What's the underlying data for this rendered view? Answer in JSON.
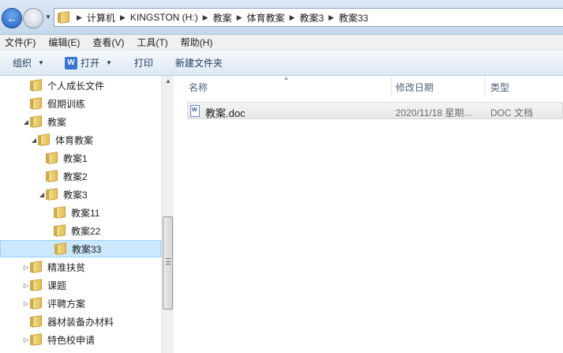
{
  "nav": {
    "back": "back-arrow",
    "forward": "forward-arrow"
  },
  "breadcrumb": [
    "计算机",
    "KINGSTON (H:)",
    "教案",
    "体育教案",
    "教案3",
    "教案33"
  ],
  "menu": [
    "文件(F)",
    "编辑(E)",
    "查看(V)",
    "工具(T)",
    "帮助(H)"
  ],
  "toolbar": {
    "organize": "组织",
    "open": "打开",
    "print": "打印",
    "new_folder": "新建文件夹"
  },
  "tree": [
    {
      "label": "个人成长文件",
      "expander": "",
      "level": 0
    },
    {
      "label": "假期训练",
      "expander": "",
      "level": 0
    },
    {
      "label": "教案",
      "expander": "expanded",
      "level": 0
    },
    {
      "label": "体育教案",
      "expander": "expanded",
      "level": 1
    },
    {
      "label": "教案1",
      "expander": "",
      "level": 2
    },
    {
      "label": "教案2",
      "expander": "",
      "level": 2
    },
    {
      "label": "教案3",
      "expander": "expanded",
      "level": 2
    },
    {
      "label": "教案11",
      "expander": "",
      "level": 3
    },
    {
      "label": "教案22",
      "expander": "",
      "level": 3
    },
    {
      "label": "教案33",
      "expander": "",
      "level": 3,
      "selected": true
    },
    {
      "label": "精准扶贫",
      "expander": "collapsed",
      "level": 0
    },
    {
      "label": "课题",
      "expander": "collapsed",
      "level": 0
    },
    {
      "label": "评聘方案",
      "expander": "collapsed",
      "level": 0
    },
    {
      "label": "器材装备办材料",
      "expander": "",
      "level": 0
    },
    {
      "label": "特色校申请",
      "expander": "collapsed",
      "level": 0
    }
  ],
  "columns": {
    "name": "名称",
    "date": "修改日期",
    "type": "类型"
  },
  "files": [
    {
      "name": "教案.doc",
      "date": "2020/11/18 星期...",
      "type": "DOC 文档",
      "icon": "word-doc-icon"
    }
  ]
}
